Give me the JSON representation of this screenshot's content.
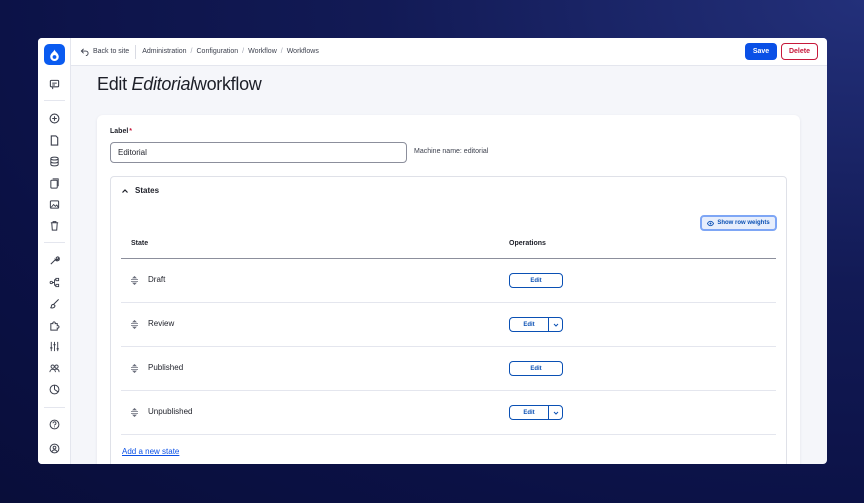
{
  "topbar": {
    "back_label": "Back to site",
    "breadcrumb": [
      "Administration",
      "Configuration",
      "Workflow",
      "Workflows"
    ],
    "save_label": "Save",
    "delete_label": "Delete"
  },
  "page": {
    "title_prefix": "Edit",
    "title_italic": "Editorial",
    "title_suffix": "workflow"
  },
  "form": {
    "label_text": "Label",
    "required_mark": "*",
    "label_value": "Editorial",
    "machine_name": "Machine name: editorial"
  },
  "states": {
    "heading": "States",
    "show_weights_label": "Show row weights",
    "col_state": "State",
    "col_operations": "Operations",
    "rows": [
      {
        "label": "Draft",
        "edit": "Edit",
        "has_dropdown": false
      },
      {
        "label": "Review",
        "edit": "Edit",
        "has_dropdown": true
      },
      {
        "label": "Published",
        "edit": "Edit",
        "has_dropdown": false
      },
      {
        "label": "Unpublished",
        "edit": "Edit",
        "has_dropdown": true
      }
    ],
    "add_link": "Add a new state"
  },
  "sidebar_icons": [
    "announcements-icon",
    "add-content-icon",
    "content-icon",
    "database-icon",
    "files-icon",
    "media-icon",
    "trash-icon",
    "tools-icon",
    "structure-icon",
    "appearance-icon",
    "extend-icon",
    "config-icon",
    "people-icon",
    "reports-icon",
    "help-icon",
    "user-icon"
  ],
  "colors": {
    "accent": "#0a50e6",
    "danger": "#c7183a",
    "background_dark": "#0b1145"
  }
}
